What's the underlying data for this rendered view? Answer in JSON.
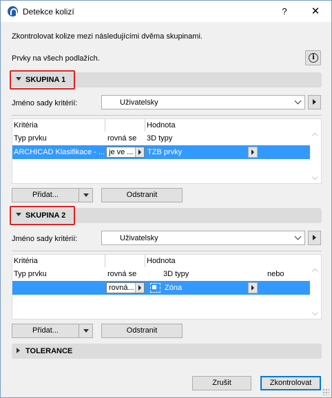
{
  "window": {
    "title": "Detekce kolizí",
    "help_label": "?",
    "close_label": "✕"
  },
  "intro": {
    "description": "Zkontrolovat kolize mezi následujícími dvěma skupinami.",
    "scope": "Prvky na všech podlažích."
  },
  "group1": {
    "title": "SKUPINA 1",
    "criteria_set_label": "Jméno sady kritérií:",
    "criteria_set_value": "Uživatelsky",
    "columns": [
      "Kritéria",
      "",
      "Hodnota"
    ],
    "header_row": {
      "criterion": "Typ prvku",
      "operator": "rovná se",
      "value": "3D typy",
      "extra": ""
    },
    "selected_row": {
      "criterion": "ARCHICAD Klasifikace - ...",
      "operator": "je ve ...",
      "value": "TZB prvky"
    },
    "add_label": "Přidat...",
    "remove_label": "Odstranit"
  },
  "group2": {
    "title": "SKUPINA 2",
    "criteria_set_label": "Jméno sady kritérií:",
    "criteria_set_value": "Uživatelsky",
    "columns": [
      "Kritéria",
      "",
      "Hodnota"
    ],
    "header_row": {
      "criterion": "Typ prvku",
      "operator": "rovná se",
      "value": "3D typy",
      "extra": "nebo"
    },
    "selected_row": {
      "criterion": "",
      "operator": "rovná...",
      "value": "Zóna"
    },
    "add_label": "Přidat...",
    "remove_label": "Odstranit"
  },
  "tolerance": {
    "title": "TOLERANCE"
  },
  "footer": {
    "cancel_label": "Zrušit",
    "check_label": "Zkontrolovat"
  },
  "colors": {
    "selection": "#3399ff",
    "highlight": "#e02020",
    "section_bar": "#dcdcdc"
  }
}
